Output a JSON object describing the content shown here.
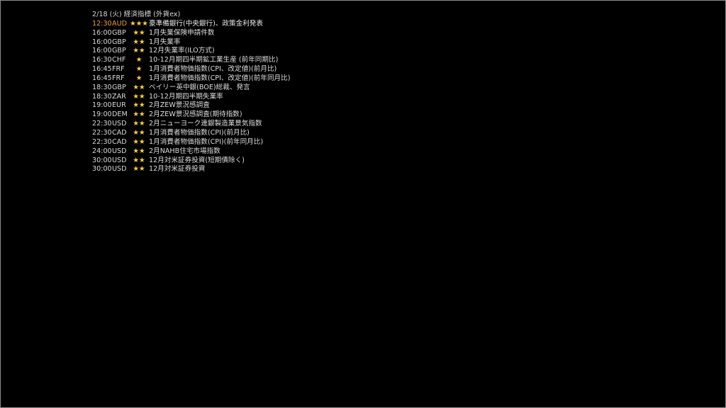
{
  "header": {
    "title": "2/18 (火) 経済指標 (外貨ex)"
  },
  "colors": {
    "highlight": "#f0a030",
    "default_text": "#d8d8d8",
    "star": "#ffd23a",
    "background": "#000000"
  },
  "events": [
    {
      "time": "12:30",
      "currency": "AUD",
      "stars": "★★★",
      "title": "豪準備銀行(中央銀行)、政策金利発表",
      "highlight": true
    },
    {
      "time": "16:00",
      "currency": "GBP",
      "stars": "★★",
      "title": "1月失業保険申請件数"
    },
    {
      "time": "16:00",
      "currency": "GBP",
      "stars": "★★",
      "title": "1月失業率"
    },
    {
      "time": "16:00",
      "currency": "GBP",
      "stars": "★★",
      "title": "12月失業率(ILO方式)"
    },
    {
      "time": "16:30",
      "currency": "CHF",
      "stars": "★",
      "title": "10-12月期四半期鉱工業生産 (前年同期比)"
    },
    {
      "time": "16:45",
      "currency": "FRF",
      "stars": "★",
      "title": "1月消費者物価指数(CPI、改定値)(前月比)"
    },
    {
      "time": "16:45",
      "currency": "FRF",
      "stars": "★",
      "title": "1月消費者物価指数(CPI、改定値)(前年同月比)"
    },
    {
      "time": "18:30",
      "currency": "GBP",
      "stars": "★★",
      "title": "ベイリー英中銀(BOE)総裁、発言"
    },
    {
      "time": "18:30",
      "currency": "ZAR",
      "stars": "★★",
      "title": "10-12月期四半期失業率"
    },
    {
      "time": "19:00",
      "currency": "EUR",
      "stars": "★★",
      "title": "2月ZEW景況感調査"
    },
    {
      "time": "19:00",
      "currency": "DEM",
      "stars": "★★",
      "title": "2月ZEW景況感調査(期待指数)"
    },
    {
      "time": "22:30",
      "currency": "USD",
      "stars": "★★",
      "title": "2月ニューヨーク連銀製造業景気指数"
    },
    {
      "time": "22:30",
      "currency": "CAD",
      "stars": "★★",
      "title": "1月消費者物価指数(CPI)(前月比)"
    },
    {
      "time": "22:30",
      "currency": "CAD",
      "stars": "★★",
      "title": "1月消費者物価指数(CPI)(前年同月比)"
    },
    {
      "time": "24:00",
      "currency": "USD",
      "stars": "★★",
      "title": "2月NAHB住宅市場指数"
    },
    {
      "time": "30:00",
      "currency": "USD",
      "stars": "★★",
      "title": "12月対米証券投資(短期債除く)"
    },
    {
      "time": "30:00",
      "currency": "USD",
      "stars": "★★",
      "title": "12月対米証券投資"
    }
  ]
}
